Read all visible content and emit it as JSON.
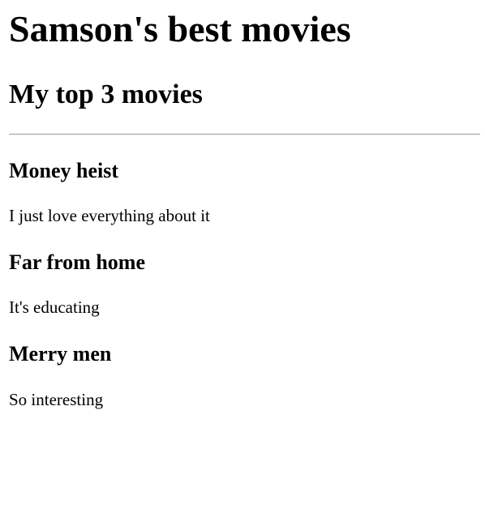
{
  "page": {
    "title": "Samson's best movies",
    "section_title": "My top 3 movies"
  },
  "movies": [
    {
      "title": "Money heist",
      "comment": "I just love everything about it"
    },
    {
      "title": "Far from home",
      "comment": "It's educating"
    },
    {
      "title": "Merry men",
      "comment": "So interesting"
    }
  ]
}
